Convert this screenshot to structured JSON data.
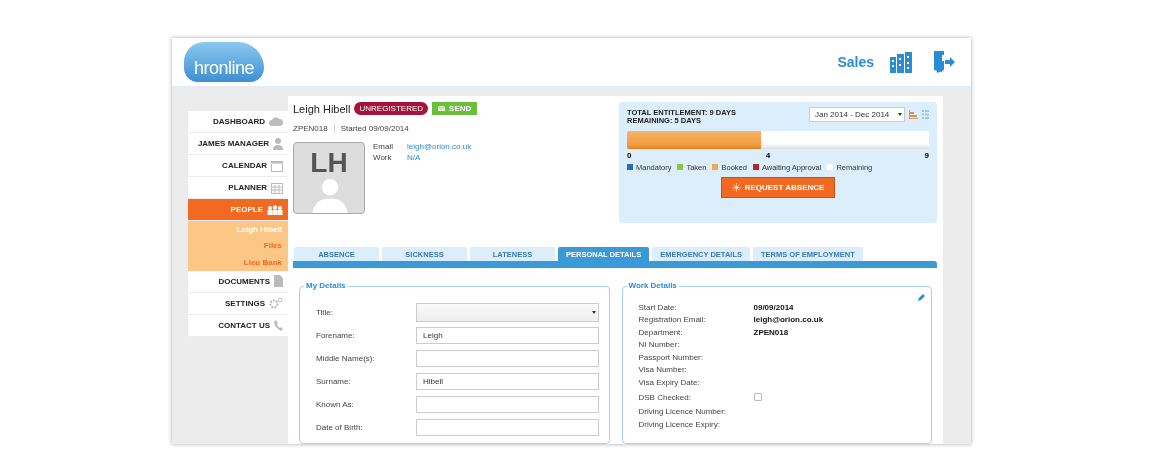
{
  "header": {
    "logo": "hronline",
    "company": "Sales"
  },
  "sidebar": {
    "items": [
      {
        "label": "DASHBOARD",
        "kind": "main",
        "selected": false
      },
      {
        "label": "JAMES MANAGER",
        "kind": "main",
        "selected": false
      },
      {
        "label": "CALENDAR",
        "kind": "main",
        "selected": false
      },
      {
        "label": "PLANNER",
        "kind": "main",
        "selected": false
      },
      {
        "label": "PEOPLE",
        "kind": "main",
        "selected": true
      },
      {
        "label": "Leigh Hibell",
        "kind": "sub",
        "selected": true
      },
      {
        "label": "Files",
        "kind": "sub",
        "selected": false
      },
      {
        "label": "Lieu Bank",
        "kind": "sub",
        "selected": false
      },
      {
        "label": "DOCUMENTS",
        "kind": "main",
        "selected": false
      },
      {
        "label": "SETTINGS",
        "kind": "main",
        "selected": false
      },
      {
        "label": "CONTACT US",
        "kind": "main",
        "selected": false
      }
    ]
  },
  "profile": {
    "name": "Leigh Hibell",
    "status_badge": "UNREGISTERED",
    "send_button": "SEND",
    "employee_id": "ZPEN018",
    "started": "Started 09/09/2014",
    "initials": "LH",
    "contacts": [
      {
        "label": "Email",
        "value": "leigh@orion.co.uk"
      },
      {
        "label": "Work",
        "value": "N/A"
      }
    ]
  },
  "entitlement": {
    "total": "TOTAL ENTITLEMENT: 9 DAYS",
    "remaining": "REMAINING: 5 DAYS",
    "period": "Jan 2014 - Dec 2014",
    "level": 0.444,
    "ticks": [
      "0",
      "4",
      "9"
    ],
    "legend": [
      {
        "label": "Mandatory",
        "color": "#2a6ebb"
      },
      {
        "label": "Taken",
        "color": "#8dc63f"
      },
      {
        "label": "Booked",
        "color": "#f7a650"
      },
      {
        "label": "Awaiting Approval",
        "color": "#b5252e"
      },
      {
        "label": "Remaining",
        "color": "#ffffff"
      }
    ],
    "request_button": "REQUEST ABSENCE"
  },
  "tabs": [
    {
      "label": "ABSENCE",
      "selected": false
    },
    {
      "label": "SICKNESS",
      "selected": false
    },
    {
      "label": "LATENESS",
      "selected": false
    },
    {
      "label": "PERSONAL DETAILS",
      "selected": true
    },
    {
      "label": "EMERGENCY DETAILS",
      "selected": false
    },
    {
      "label": "TERMS OF EMPLOYMENT",
      "selected": false
    }
  ],
  "my_details": {
    "title": "My Details",
    "fields": [
      {
        "label": "Title:",
        "kind": "select"
      },
      {
        "label": "Forename:",
        "kind": "input",
        "value": "Leigh"
      },
      {
        "label": "Middle Name(s):",
        "kind": "input"
      },
      {
        "label": "Surname:",
        "kind": "input",
        "value": "Hibell"
      },
      {
        "label": "Known As:",
        "kind": "input"
      },
      {
        "label": "Date of Birth:",
        "kind": "input"
      }
    ]
  },
  "work_details": {
    "title": "Work Details",
    "rows": [
      {
        "label": "Start Date:",
        "kind": "text",
        "value": "09/09/2014"
      },
      {
        "label": "Registration Email:",
        "kind": "text",
        "value": "leigh@orion.co.uk"
      },
      {
        "label": "Department:",
        "kind": "text",
        "value": "ZPEN018"
      },
      {
        "label": "NI Number:",
        "kind": "text"
      },
      {
        "label": "Passport Number:",
        "kind": "text"
      },
      {
        "label": "Visa Number:",
        "kind": "text"
      },
      {
        "label": "Visa Expiry Date:",
        "kind": "text"
      },
      {
        "label": "DSB Checked:",
        "kind": "checkbox",
        "checked": false
      },
      {
        "label": "Driving Licence Number:",
        "kind": "text"
      },
      {
        "label": "Driving Licence Expiry:",
        "kind": "text"
      }
    ]
  }
}
